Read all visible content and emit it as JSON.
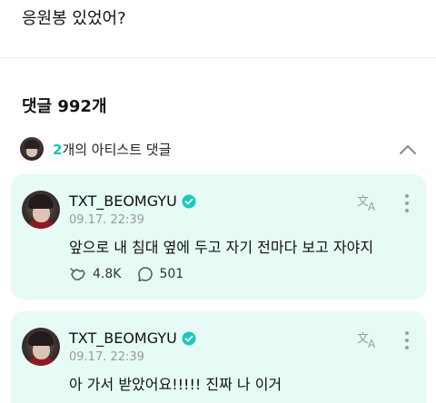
{
  "post": {
    "text": "응원봉 있었어?"
  },
  "comments_header": {
    "title": "댓글 992개"
  },
  "artist_comments": {
    "count": "2",
    "suffix": "개의 아티스트 댓글"
  },
  "comments": [
    {
      "author": "TXT_BEOMGYU",
      "timestamp": "09.17. 22:39",
      "text": "앞으로 내 침대 옆에 두고 자기 전마다 보고 자야지",
      "likes": "4.8K",
      "replies": "501"
    },
    {
      "author": "TXT_BEOMGYU",
      "timestamp": "09.17. 22:39",
      "text": "아 가서 받았어요!!!!! 진짜 나 이거"
    }
  ],
  "colors": {
    "accent": "#10c8b4",
    "card_bg": "#e6fbf6",
    "verified": "#1ec8b8"
  },
  "icons": [
    "chevron-up-icon",
    "verified-icon",
    "translate-icon",
    "more-icon",
    "like-icon",
    "reply-icon"
  ]
}
